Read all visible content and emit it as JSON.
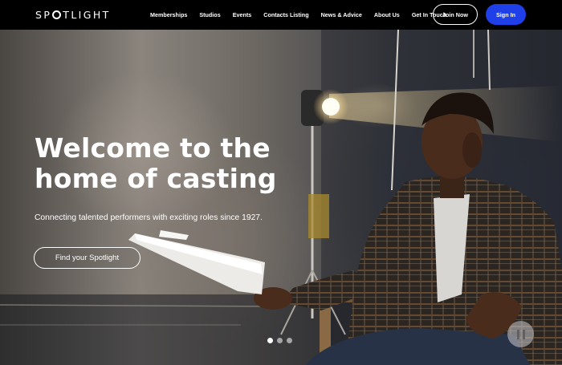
{
  "brand": {
    "logo_left": "SP",
    "logo_right": "TLIGHT"
  },
  "nav": {
    "items": [
      {
        "label": "Memberships"
      },
      {
        "label": "Studios"
      },
      {
        "label": "Events"
      },
      {
        "label": "Contacts Listing"
      },
      {
        "label": "News & Advice"
      },
      {
        "label": "About Us"
      },
      {
        "label": "Get In Touch"
      }
    ],
    "join_label": "Join Now",
    "signin_label": "Sign In"
  },
  "hero": {
    "title": "Welcome to the home of casting",
    "subtitle": "Connecting talented performers with exciting roles since 1927.",
    "cta_label": "Find your Spotlight",
    "carousel": {
      "slides": 3,
      "active": 1
    }
  },
  "colors": {
    "signin_bg": "#1f3fe8",
    "nav_bg": "#000000"
  },
  "icons": {
    "pause": "pause-icon"
  }
}
